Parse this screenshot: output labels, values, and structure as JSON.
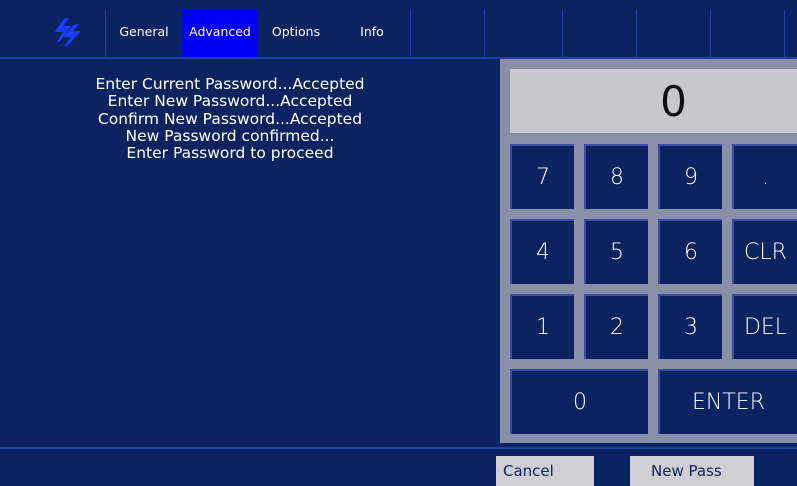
{
  "tabs": [
    {
      "label": "General"
    },
    {
      "label": "Advanced"
    },
    {
      "label": "Options"
    },
    {
      "label": "Info"
    }
  ],
  "active_tab": "Advanced",
  "messages": [
    "Enter Current Password...Accepted",
    "Enter New Password...Accepted",
    "Confirm New Password...Accepted",
    "New Password confirmed...",
    "Enter Password to proceed"
  ],
  "keypad": {
    "display_value": "0",
    "keys": {
      "k7": "7",
      "k8": "8",
      "k9": "9",
      "kdot": ".",
      "k4": "4",
      "k5": "5",
      "k6": "6",
      "kclr": "CLR",
      "k1": "1",
      "k2": "2",
      "k3": "3",
      "kdel": "DEL",
      "k0": "0",
      "kenter": "ENTER"
    }
  },
  "buttons": {
    "cancel": "Cancel",
    "new_pass": "New Pass"
  },
  "colors": {
    "background": "#0b2461",
    "active_tab": "#0000f5",
    "keypad_frame": "#888fa6",
    "display": "#c8c8cc",
    "bottom_button": "#cfcfd3"
  },
  "icons": {
    "logo": "lightning-logo-icon"
  }
}
